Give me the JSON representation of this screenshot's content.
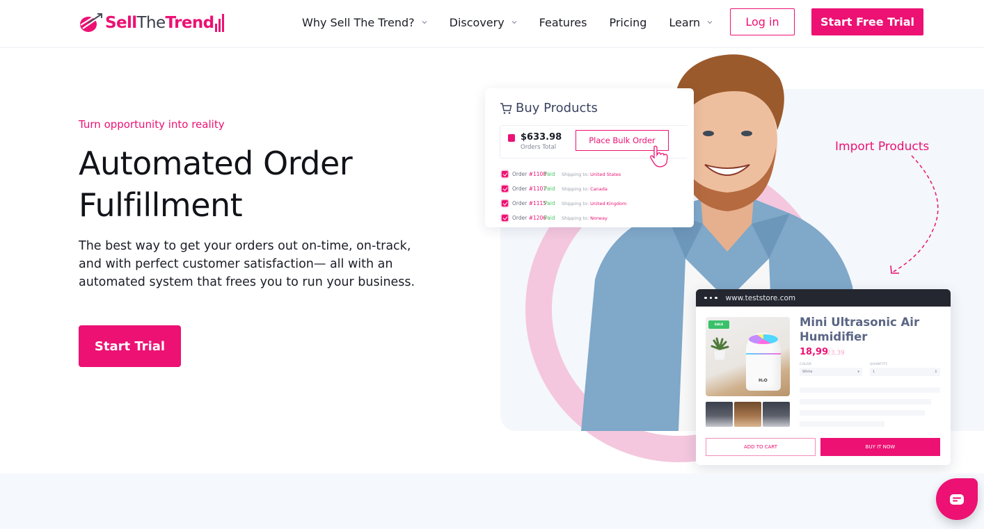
{
  "brand": {
    "name_part1": "Sell",
    "name_part2": "The",
    "name_part3": "Trend",
    "accent_color": "#ec1173"
  },
  "nav": {
    "items": [
      {
        "label": "Why Sell The Trend?",
        "has_dropdown": true
      },
      {
        "label": "Discovery",
        "has_dropdown": true
      },
      {
        "label": "Features",
        "has_dropdown": false
      },
      {
        "label": "Pricing",
        "has_dropdown": false
      },
      {
        "label": "Learn",
        "has_dropdown": true
      }
    ],
    "login_label": "Log in",
    "trial_label": "Start Free Trial"
  },
  "hero": {
    "eyebrow": "Turn opportunity into reality",
    "headline_line1": "Automated Order",
    "headline_line2": "Fulfillment",
    "description": "The best way to get your orders out on-time, on-track, and with perfect customer satisfaction— all with an automated system that frees you to run your business.",
    "cta_label": "Start Trial"
  },
  "buy_card": {
    "title": "Buy Products",
    "total_value": "$633.98",
    "total_label": "Orders Total",
    "bulk_button": "Place Bulk Order",
    "orders": [
      {
        "prefix": "Order ",
        "number": "#1108",
        "status": "Paid",
        "ship_label": "Shipping to:",
        "country": "United States"
      },
      {
        "prefix": "Order ",
        "number": "#1107",
        "status": "Paid",
        "ship_label": "Shipping to:",
        "country": "Canada"
      },
      {
        "prefix": "Order ",
        "number": "#1115",
        "status": "Paid",
        "ship_label": "Shipping to:",
        "country": "United Kingdom"
      },
      {
        "prefix": "Order ",
        "number": "#1206",
        "status": "Paid",
        "ship_label": "Shipping to:",
        "country": "Norway"
      }
    ]
  },
  "import_label": "Import Products",
  "store_card": {
    "url": "www.teststore.com",
    "sale_tag": "SALE",
    "product_title": "Mini Ultrasonic Air Humidifier",
    "price": "18,99",
    "old_price": "23,39",
    "color_label": "COLOR",
    "color_value": "White",
    "quantity_label": "QUANTITY",
    "quantity_value": "1",
    "h2o_label": "H₂O",
    "add_to_cart": "ADD TO CART",
    "buy_now": "BUY IT NOW"
  },
  "chat": {
    "icon": "chat-bubble-icon"
  }
}
